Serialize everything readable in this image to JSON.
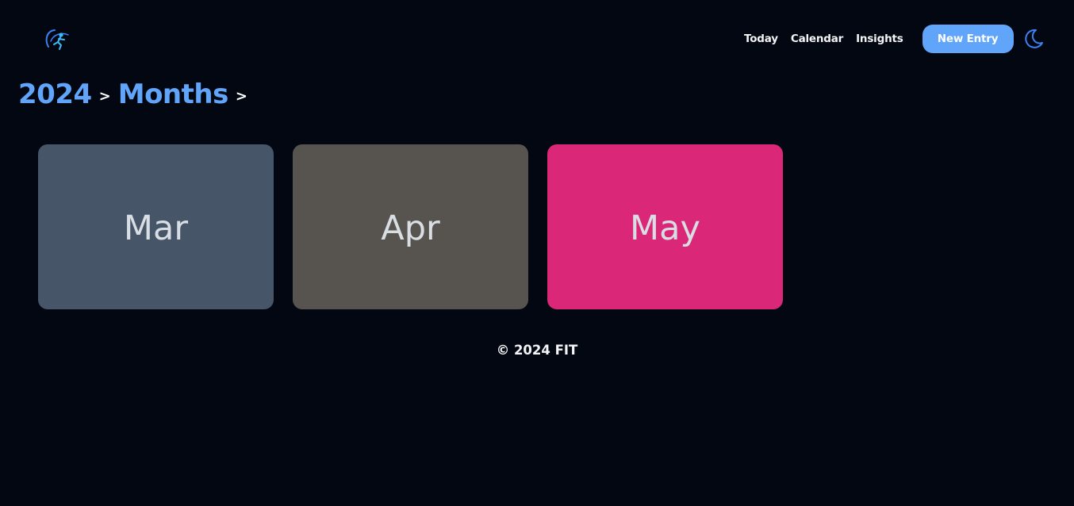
{
  "header": {
    "logo_icon": "runner-logo-icon",
    "nav": {
      "today": "Today",
      "calendar": "Calendar",
      "insights": "Insights"
    },
    "new_entry_label": "New Entry",
    "theme_icon": "moon-icon"
  },
  "breadcrumb": {
    "year": "2024",
    "sep1": ">",
    "months": "Months",
    "sep2": ">"
  },
  "months": [
    {
      "label": "Mar",
      "color": "#475569"
    },
    {
      "label": "Apr",
      "color": "#57534e"
    },
    {
      "label": "May",
      "color": "#db2777"
    }
  ],
  "footer": {
    "text": "© 2024 FIT"
  },
  "colors": {
    "background": "#030712",
    "accent": "#60a5fa"
  }
}
